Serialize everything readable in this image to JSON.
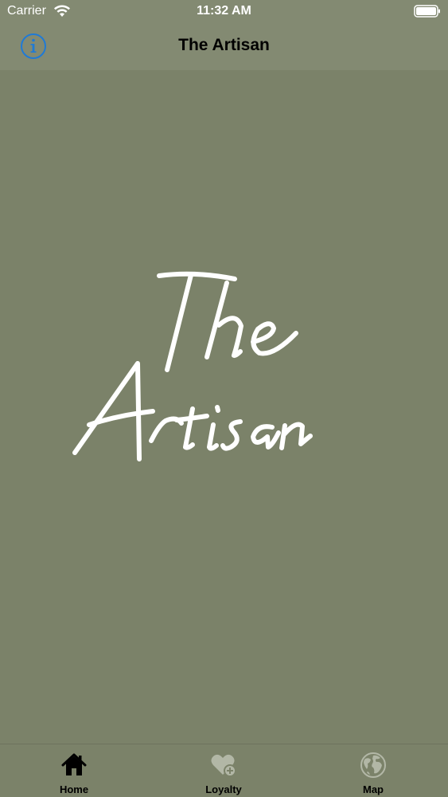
{
  "status_bar": {
    "carrier": "Carrier",
    "time": "11:32 AM",
    "icons": [
      "wifi-icon",
      "battery-icon"
    ]
  },
  "nav_bar": {
    "title": "The Artisan",
    "left_icon": "info-icon"
  },
  "main": {
    "logo_text": "The Artisan"
  },
  "tab_bar": {
    "items": [
      {
        "label": "Home",
        "icon": "house-icon",
        "selected": true
      },
      {
        "label": "Loyalty",
        "icon": "heart-plus-icon",
        "selected": false
      },
      {
        "label": "Map",
        "icon": "globe-icon",
        "selected": false
      }
    ]
  },
  "colors": {
    "background": "#7b8269",
    "bars": "#838a72",
    "accent": "#1f7ad6",
    "text": "#000000",
    "logo": "#ffffff"
  }
}
